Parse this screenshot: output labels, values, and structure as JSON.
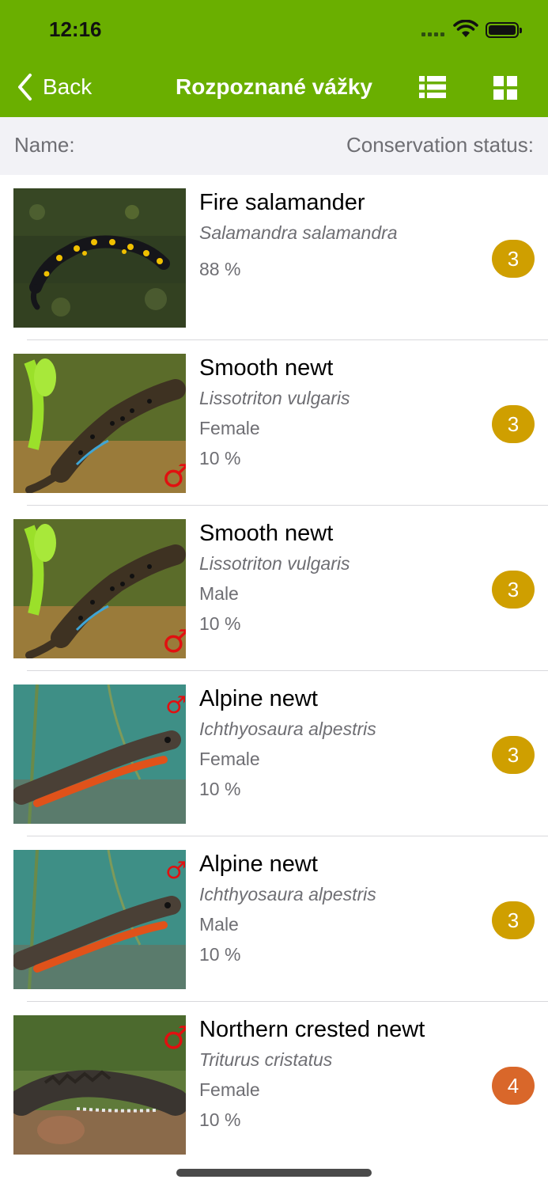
{
  "status_bar": {
    "time": "12:16"
  },
  "nav": {
    "back_label": "Back",
    "title": "Rozpoznané vážky",
    "list_view_icon": "list-icon",
    "grid_view_icon": "grid-icon",
    "accent_color": "#6aaf00"
  },
  "header": {
    "name_label": "Name:",
    "status_label": "Conservation status:"
  },
  "items": [
    {
      "common": "Fire salamander",
      "latin": "Salamandra salamandra",
      "sex": "",
      "percent": "88 %",
      "status": "3",
      "status_color": "#cf9f00",
      "image": "fire-salamander-image",
      "sex_symbol": ""
    },
    {
      "common": "Smooth newt",
      "latin": "Lissotriton vulgaris",
      "sex": "Female",
      "percent": "10 %",
      "status": "3",
      "status_color": "#cf9f00",
      "image": "smooth-newt-image",
      "sex_symbol": "♂"
    },
    {
      "common": "Smooth newt",
      "latin": "Lissotriton vulgaris",
      "sex": "Male",
      "percent": "10 %",
      "status": "3",
      "status_color": "#cf9f00",
      "image": "smooth-newt-image",
      "sex_symbol": "♂"
    },
    {
      "common": "Alpine newt",
      "latin": "Ichthyosaura alpestris",
      "sex": "Female",
      "percent": "10 %",
      "status": "3",
      "status_color": "#cf9f00",
      "image": "alpine-newt-image",
      "sex_symbol": "♂"
    },
    {
      "common": "Alpine newt",
      "latin": "Ichthyosaura alpestris",
      "sex": "Male",
      "percent": "10 %",
      "status": "3",
      "status_color": "#cf9f00",
      "image": "alpine-newt-image",
      "sex_symbol": "♂"
    },
    {
      "common": "Northern crested newt",
      "latin": "Triturus cristatus",
      "sex": "Female",
      "percent": "10 %",
      "status": "4",
      "status_color": "#d9672a",
      "image": "crested-newt-image",
      "sex_symbol": "♂"
    }
  ]
}
